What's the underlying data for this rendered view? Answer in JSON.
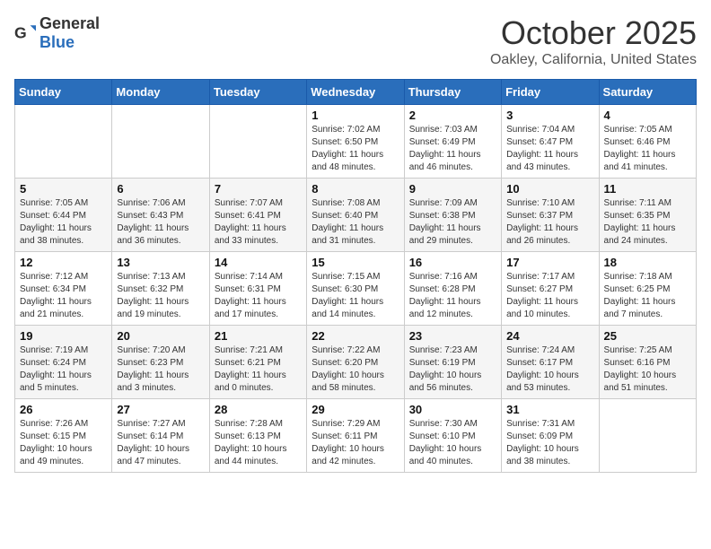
{
  "logo": {
    "general": "General",
    "blue": "Blue"
  },
  "header": {
    "month": "October 2025",
    "location": "Oakley, California, United States"
  },
  "weekdays": [
    "Sunday",
    "Monday",
    "Tuesday",
    "Wednesday",
    "Thursday",
    "Friday",
    "Saturday"
  ],
  "weeks": [
    [
      {
        "day": null
      },
      {
        "day": null
      },
      {
        "day": null
      },
      {
        "day": "1",
        "sunrise": "7:02 AM",
        "sunset": "6:50 PM",
        "daylight": "11 hours and 48 minutes."
      },
      {
        "day": "2",
        "sunrise": "7:03 AM",
        "sunset": "6:49 PM",
        "daylight": "11 hours and 46 minutes."
      },
      {
        "day": "3",
        "sunrise": "7:04 AM",
        "sunset": "6:47 PM",
        "daylight": "11 hours and 43 minutes."
      },
      {
        "day": "4",
        "sunrise": "7:05 AM",
        "sunset": "6:46 PM",
        "daylight": "11 hours and 41 minutes."
      }
    ],
    [
      {
        "day": "5",
        "sunrise": "7:05 AM",
        "sunset": "6:44 PM",
        "daylight": "11 hours and 38 minutes."
      },
      {
        "day": "6",
        "sunrise": "7:06 AM",
        "sunset": "6:43 PM",
        "daylight": "11 hours and 36 minutes."
      },
      {
        "day": "7",
        "sunrise": "7:07 AM",
        "sunset": "6:41 PM",
        "daylight": "11 hours and 33 minutes."
      },
      {
        "day": "8",
        "sunrise": "7:08 AM",
        "sunset": "6:40 PM",
        "daylight": "11 hours and 31 minutes."
      },
      {
        "day": "9",
        "sunrise": "7:09 AM",
        "sunset": "6:38 PM",
        "daylight": "11 hours and 29 minutes."
      },
      {
        "day": "10",
        "sunrise": "7:10 AM",
        "sunset": "6:37 PM",
        "daylight": "11 hours and 26 minutes."
      },
      {
        "day": "11",
        "sunrise": "7:11 AM",
        "sunset": "6:35 PM",
        "daylight": "11 hours and 24 minutes."
      }
    ],
    [
      {
        "day": "12",
        "sunrise": "7:12 AM",
        "sunset": "6:34 PM",
        "daylight": "11 hours and 21 minutes."
      },
      {
        "day": "13",
        "sunrise": "7:13 AM",
        "sunset": "6:32 PM",
        "daylight": "11 hours and 19 minutes."
      },
      {
        "day": "14",
        "sunrise": "7:14 AM",
        "sunset": "6:31 PM",
        "daylight": "11 hours and 17 minutes."
      },
      {
        "day": "15",
        "sunrise": "7:15 AM",
        "sunset": "6:30 PM",
        "daylight": "11 hours and 14 minutes."
      },
      {
        "day": "16",
        "sunrise": "7:16 AM",
        "sunset": "6:28 PM",
        "daylight": "11 hours and 12 minutes."
      },
      {
        "day": "17",
        "sunrise": "7:17 AM",
        "sunset": "6:27 PM",
        "daylight": "11 hours and 10 minutes."
      },
      {
        "day": "18",
        "sunrise": "7:18 AM",
        "sunset": "6:25 PM",
        "daylight": "11 hours and 7 minutes."
      }
    ],
    [
      {
        "day": "19",
        "sunrise": "7:19 AM",
        "sunset": "6:24 PM",
        "daylight": "11 hours and 5 minutes."
      },
      {
        "day": "20",
        "sunrise": "7:20 AM",
        "sunset": "6:23 PM",
        "daylight": "11 hours and 3 minutes."
      },
      {
        "day": "21",
        "sunrise": "7:21 AM",
        "sunset": "6:21 PM",
        "daylight": "11 hours and 0 minutes."
      },
      {
        "day": "22",
        "sunrise": "7:22 AM",
        "sunset": "6:20 PM",
        "daylight": "10 hours and 58 minutes."
      },
      {
        "day": "23",
        "sunrise": "7:23 AM",
        "sunset": "6:19 PM",
        "daylight": "10 hours and 56 minutes."
      },
      {
        "day": "24",
        "sunrise": "7:24 AM",
        "sunset": "6:17 PM",
        "daylight": "10 hours and 53 minutes."
      },
      {
        "day": "25",
        "sunrise": "7:25 AM",
        "sunset": "6:16 PM",
        "daylight": "10 hours and 51 minutes."
      }
    ],
    [
      {
        "day": "26",
        "sunrise": "7:26 AM",
        "sunset": "6:15 PM",
        "daylight": "10 hours and 49 minutes."
      },
      {
        "day": "27",
        "sunrise": "7:27 AM",
        "sunset": "6:14 PM",
        "daylight": "10 hours and 47 minutes."
      },
      {
        "day": "28",
        "sunrise": "7:28 AM",
        "sunset": "6:13 PM",
        "daylight": "10 hours and 44 minutes."
      },
      {
        "day": "29",
        "sunrise": "7:29 AM",
        "sunset": "6:11 PM",
        "daylight": "10 hours and 42 minutes."
      },
      {
        "day": "30",
        "sunrise": "7:30 AM",
        "sunset": "6:10 PM",
        "daylight": "10 hours and 40 minutes."
      },
      {
        "day": "31",
        "sunrise": "7:31 AM",
        "sunset": "6:09 PM",
        "daylight": "10 hours and 38 minutes."
      },
      {
        "day": null
      }
    ]
  ]
}
